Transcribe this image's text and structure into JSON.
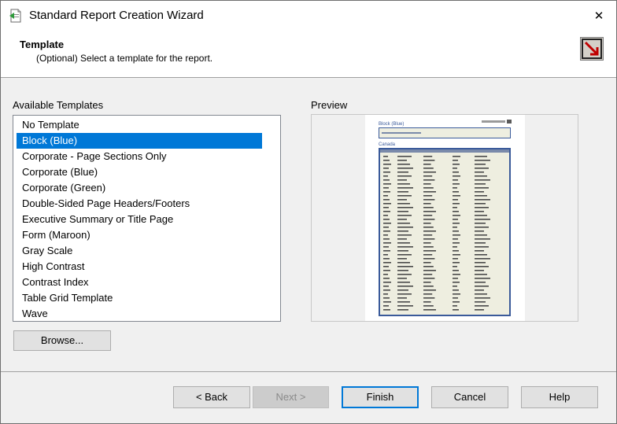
{
  "window": {
    "title": "Standard Report Creation Wizard",
    "close_glyph": "✕"
  },
  "header": {
    "title": "Template",
    "subtitle": "(Optional) Select a template for the report."
  },
  "templates": {
    "label": "Available Templates",
    "items": [
      "No Template",
      "Block (Blue)",
      "Corporate - Page Sections Only",
      "Corporate (Blue)",
      "Corporate (Green)",
      "Double-Sided Page Headers/Footers",
      "Executive Summary or Title Page",
      "Form (Maroon)",
      "Gray Scale",
      "High Contrast",
      "Contrast Index",
      "Table Grid Template",
      "Wave"
    ],
    "selected_index": 1,
    "browse_label": "Browse..."
  },
  "preview": {
    "label": "Preview",
    "page_title": "Block (Blue)",
    "section_label": "Canada"
  },
  "buttons": {
    "back": "< Back",
    "next": "Next >",
    "finish": "Finish",
    "cancel": "Cancel",
    "help": "Help"
  },
  "colors": {
    "selection": "#0078d7",
    "preview_accent": "#3a5a9a",
    "preview_fill": "#eeeee0"
  },
  "icons": {
    "app": "report-wizard-icon",
    "wizard": "wizard-arrow-icon",
    "close": "close-icon"
  }
}
